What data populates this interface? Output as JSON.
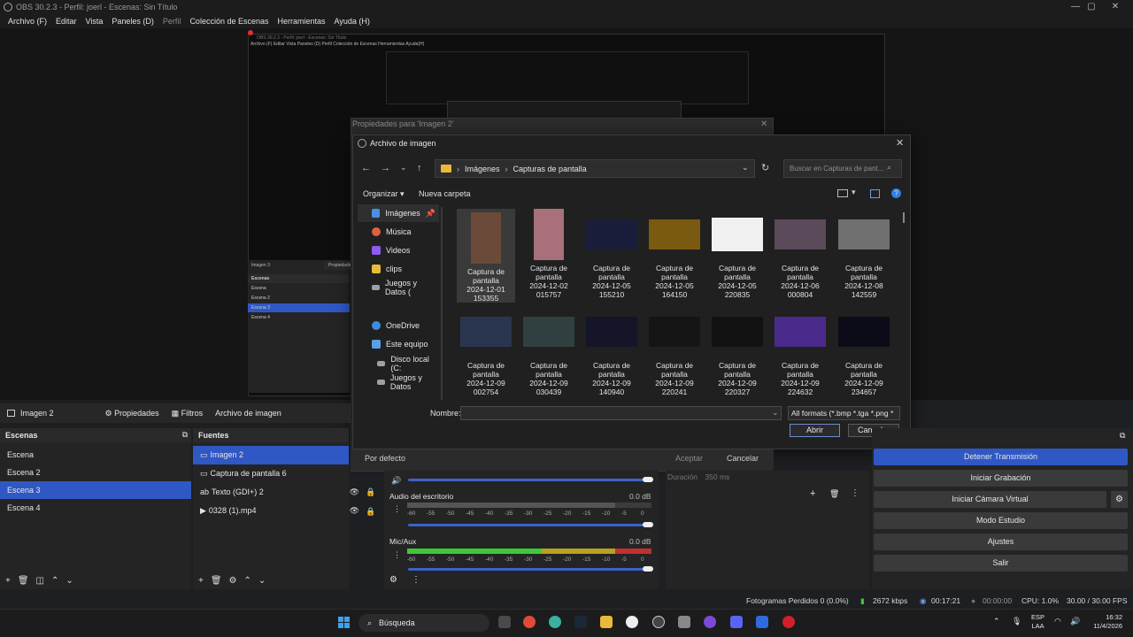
{
  "window": {
    "title": "OBS 30.2.3 - Perfil: joerl - Escenas: Sin Título"
  },
  "menu": [
    "Archivo (F)",
    "Editar",
    "Vista",
    "Paneles (D)",
    "Perfil",
    "Colección de Escenas",
    "Herramientas",
    "Ayuda (H)"
  ],
  "properties_dialog": {
    "title": "Propiedades para 'Imagen 2'",
    "defaults": "Por defecto",
    "accept": "Aceptar",
    "cancel": "Cancelar",
    "duration_label": "Duración",
    "duration_value": "350 ms"
  },
  "file_dialog": {
    "title": "Archivo de imagen",
    "breadcrumb": [
      "Imágenes",
      "Capturas de pantalla"
    ],
    "search_placeholder": "Buscar en Capturas de pant...",
    "organize": "Organizar",
    "new_folder": "Nueva carpeta",
    "nav": [
      {
        "label": "Imágenes",
        "color": "#4a90e2"
      },
      {
        "label": "Música",
        "color": "#e06040"
      },
      {
        "label": "Videos",
        "color": "#8b5cf6"
      },
      {
        "label": "clips",
        "color": "#e8b93a"
      },
      {
        "label": "Juegos y Datos (",
        "color": "#9aa0a6"
      },
      {
        "label": "OneDrive",
        "color": "#3b8ee0"
      },
      {
        "label": "Este equipo",
        "color": "#5aa0e8"
      },
      {
        "label": "Disco local (C:",
        "color": "#9aa0a6"
      },
      {
        "label": "Juegos y Datos",
        "color": "#9aa0a6"
      }
    ],
    "files": [
      {
        "name": "Captura de pantalla",
        "date": "2024-12-01",
        "time": "153355",
        "tint": "#6b4a3a"
      },
      {
        "name": "Captura de pantalla",
        "date": "2024-12-02",
        "time": "015757",
        "tint": "#a8707a"
      },
      {
        "name": "Captura de pantalla",
        "date": "2024-12-05",
        "time": "155210",
        "tint": "#1a1d3a"
      },
      {
        "name": "Captura de pantalla",
        "date": "2024-12-05",
        "time": "164150",
        "tint": "#7a5a10"
      },
      {
        "name": "Captura de pantalla",
        "date": "2024-12-05",
        "time": "220835",
        "tint": "#f0f0f0"
      },
      {
        "name": "Captura de pantalla",
        "date": "2024-12-06",
        "time": "000804",
        "tint": "#5a4a5a"
      },
      {
        "name": "Captura de pantalla",
        "date": "2024-12-08",
        "time": "142559",
        "tint": "#707070"
      },
      {
        "name": "Captura de pantalla",
        "date": "2024-12-09",
        "time": "002754",
        "tint": "#2a3550"
      },
      {
        "name": "Captura de pantalla",
        "date": "2024-12-09",
        "time": "030439",
        "tint": "#304040"
      },
      {
        "name": "Captura de pantalla",
        "date": "2024-12-09",
        "time": "140940",
        "tint": "#15152a"
      },
      {
        "name": "Captura de pantalla",
        "date": "2024-12-09",
        "time": "220241",
        "tint": "#151515"
      },
      {
        "name": "Captura de pantalla",
        "date": "2024-12-09",
        "time": "220327",
        "tint": "#121212"
      },
      {
        "name": "Captura de pantalla",
        "date": "2024-12-09",
        "time": "224632",
        "tint": "#4a2a8a"
      },
      {
        "name": "Captura de pantalla",
        "date": "2024-12-09",
        "time": "234657",
        "tint": "#0c0c18"
      }
    ],
    "filename_label": "Nombre:",
    "filename_value": "",
    "filter": "All formats (*.bmp *.tga *.png *",
    "open": "Abrir",
    "cancel": "Cancelar"
  },
  "source_toolbar": {
    "source": "Imagen 2",
    "properties": "Propiedades",
    "filters": "Filtros",
    "image_file": "Archivo de imagen"
  },
  "scenes": {
    "title": "Escenas",
    "items": [
      "Escena",
      "Escena 2",
      "Escena 3",
      "Escena 4"
    ],
    "selected": 2
  },
  "sources": {
    "title": "Fuentes",
    "items": [
      "Imagen 2",
      "Captura de pantalla 6",
      "Texto (GDI+) 2",
      "0328 (1).mp4"
    ],
    "selected": 0
  },
  "mixer": {
    "channels": [
      {
        "name": "Audio del escritorio",
        "db": "0.0 dB"
      },
      {
        "name": "Mic/Aux",
        "db": "0.0 dB"
      }
    ],
    "scale": [
      "-60",
      "-55",
      "-50",
      "-45",
      "-40",
      "-35",
      "-30",
      "-25",
      "-20",
      "-15",
      "-10",
      "-5",
      "0"
    ]
  },
  "controls": [
    "Detener Transmisión",
    "Iniciar Grabación",
    "Iniciar Cámara Virtual",
    "Modo Estudio",
    "Ajustes",
    "Salir"
  ],
  "status": {
    "dropped": "Fotogramas Perdidos 0 (0.0%)",
    "bitrate": "2672 kbps",
    "stream_time": "00:17:21",
    "rec_time": "00:00:00",
    "cpu": "CPU: 1.0%",
    "fps": "30.00 / 30.00 FPS"
  },
  "taskbar": {
    "search": "Búsqueda",
    "lang1": "ESP",
    "lang2": "LAA",
    "time": "16:32",
    "date": "11/4/2026"
  },
  "nested": {
    "menu": "Archivo (F)  Editar  Vista  Paneles (D)  Perfil  Colección de Escenas  Herramientas  Ayuda(H)",
    "title": "OBS 30.2.3 - Perfil: joerl - Escenas: Sin Título",
    "scenes_header": "Escenas",
    "scenes": [
      "Escena",
      "Escena 2",
      "Escena 3",
      "Escena 4"
    ],
    "source_label": "Imagen 3",
    "props_label": "Propiedades"
  },
  "colors": {
    "accent": "#2f58c4",
    "meter_green": "#3fc93a",
    "meter_yellow": "#b8a020",
    "meter_red": "#c23030"
  }
}
